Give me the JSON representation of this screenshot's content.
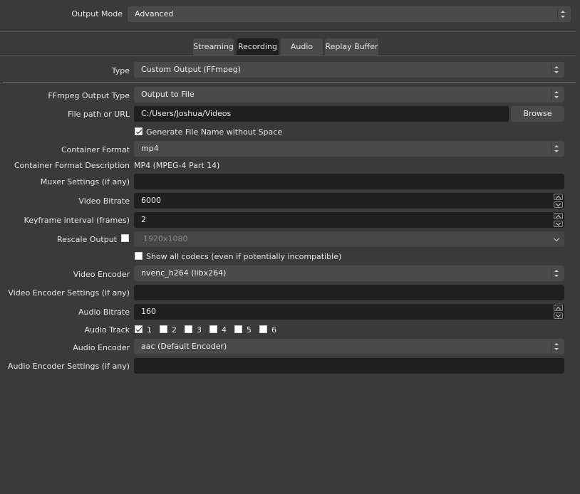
{
  "output_mode": {
    "label": "Output Mode",
    "value": "Advanced"
  },
  "tabs": [
    {
      "label": "Streaming",
      "active": false
    },
    {
      "label": "Recording",
      "active": true
    },
    {
      "label": "Audio",
      "active": false
    },
    {
      "label": "Replay Buffer",
      "active": false
    }
  ],
  "type": {
    "label": "Type",
    "value": "Custom Output (FFmpeg)"
  },
  "ffmpeg_output_type": {
    "label": "FFmpeg Output Type",
    "value": "Output to File"
  },
  "file_path": {
    "label": "File path or URL",
    "value": "C:/Users/Joshua/Videos",
    "browse_label": "Browse"
  },
  "generate_file_name": {
    "label": "Generate File Name without Space",
    "checked": true
  },
  "container_format": {
    "label": "Container Format",
    "value": "mp4"
  },
  "container_format_description": {
    "label": "Container Format Description",
    "value": "MP4 (MPEG-4 Part 14)"
  },
  "muxer_settings": {
    "label": "Muxer Settings (if any)",
    "value": ""
  },
  "video_bitrate": {
    "label": "Video Bitrate",
    "value": "6000"
  },
  "keyframe_interval": {
    "label": "Keyframe interval (frames)",
    "value": "2"
  },
  "rescale_output": {
    "label": "Rescale Output",
    "checked": false,
    "value": "1920x1080"
  },
  "show_all_codecs": {
    "label": "Show all codecs (even if potentially incompatible)",
    "checked": false
  },
  "video_encoder": {
    "label": "Video Encoder",
    "value": "nvenc_h264 (libx264)"
  },
  "video_encoder_settings": {
    "label": "Video Encoder Settings (if any)",
    "value": ""
  },
  "audio_bitrate": {
    "label": "Audio Bitrate",
    "value": "160"
  },
  "audio_track": {
    "label": "Audio Track",
    "tracks": [
      {
        "label": "1",
        "checked": true
      },
      {
        "label": "2",
        "checked": false
      },
      {
        "label": "3",
        "checked": false
      },
      {
        "label": "4",
        "checked": false
      },
      {
        "label": "5",
        "checked": false
      },
      {
        "label": "6",
        "checked": false
      }
    ]
  },
  "audio_encoder": {
    "label": "Audio Encoder",
    "value": "aac (Default Encoder)"
  },
  "audio_encoder_settings": {
    "label": "Audio Encoder Settings (if any)",
    "value": ""
  }
}
